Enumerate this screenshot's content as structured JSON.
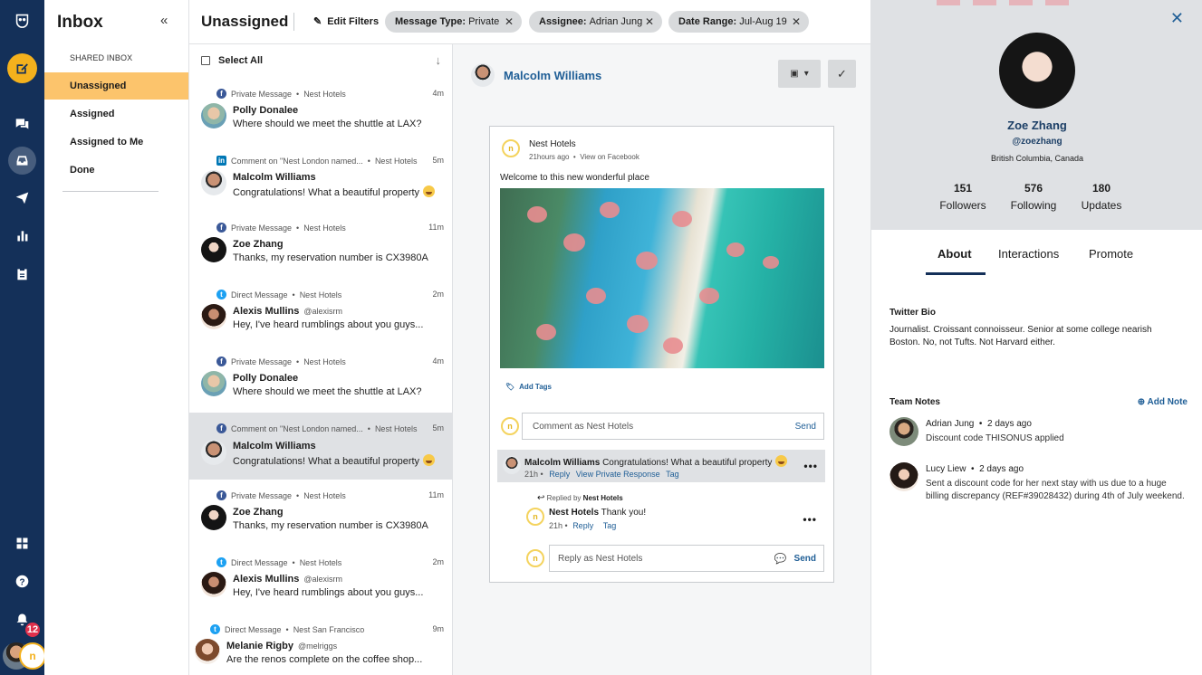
{
  "nav": {
    "title": "Inbox",
    "section_label": "SHARED INBOX",
    "items": [
      {
        "label": "Unassigned"
      },
      {
        "label": "Assigned"
      },
      {
        "label": "Assigned to Me"
      },
      {
        "label": "Done"
      }
    ]
  },
  "rail": {
    "notifications_count": "12"
  },
  "topbar": {
    "title": "Unassigned",
    "edit_filters": "Edit Filters",
    "filters": [
      {
        "key": "Message Type:",
        "value": "Private"
      },
      {
        "key": "Assignee:",
        "value": "Adrian Jung"
      },
      {
        "key": "Date Range:",
        "value": "Jul-Aug 19"
      }
    ]
  },
  "list": {
    "select_all": "Select All",
    "messages": [
      {
        "network": "facebook",
        "type": "Private Message",
        "account": "Nest Hotels",
        "time": "4m",
        "name": "Polly Donalee",
        "handle": "",
        "text": "Where should we meet the shuttle at LAX?"
      },
      {
        "network": "linkedin",
        "type": "Comment on \"Nest London named...",
        "account": "Nest Hotels",
        "time": "5m",
        "name": "Malcolm Williams",
        "handle": "",
        "text": "Congratulations! What a beautiful property"
      },
      {
        "network": "facebook",
        "type": "Private Message",
        "account": "Nest Hotels",
        "time": "11m",
        "name": "Zoe Zhang",
        "handle": "",
        "text": "Thanks, my reservation number is CX3980A"
      },
      {
        "network": "twitter",
        "type": "Direct Message",
        "account": "Nest Hotels",
        "time": "2m",
        "name": "Alexis Mullins",
        "handle": "@alexisrm",
        "text": "Hey, I've heard rumblings about you guys..."
      },
      {
        "network": "facebook",
        "type": "Private Message",
        "account": "Nest Hotels",
        "time": "4m",
        "name": "Polly Donalee",
        "handle": "",
        "text": "Where should we meet the shuttle at LAX?"
      },
      {
        "network": "facebook",
        "type": "Comment on \"Nest London named...",
        "account": "Nest Hotels",
        "time": "5m",
        "name": "Malcolm Williams",
        "handle": "",
        "text": "Congratulations! What a beautiful property"
      },
      {
        "network": "facebook",
        "type": "Private Message",
        "account": "Nest Hotels",
        "time": "11m",
        "name": "Zoe Zhang",
        "handle": "",
        "text": "Thanks, my reservation number is CX3980A"
      },
      {
        "network": "twitter",
        "type": "Direct Message",
        "account": "Nest Hotels",
        "time": "2m",
        "name": "Alexis Mullins",
        "handle": "@alexisrm",
        "text": "Hey, I've heard rumblings about you guys..."
      },
      {
        "network": "twitter",
        "type": "Direct Message",
        "account": "Nest San Francisco",
        "time": "9m",
        "name": "Melanie Rigby",
        "handle": "@melriggs",
        "text": "Are the renos complete on the coffee shop..."
      }
    ]
  },
  "convo": {
    "name": "Malcolm Williams",
    "post": {
      "author": "Nest Hotels",
      "time": "21hours ago",
      "view_link": "View on Facebook",
      "caption": "Welcome to this new wonderful place",
      "add_tags": "Add Tags",
      "comment_placeholder": "Comment as Nest Hotels",
      "send": "Send"
    },
    "comment": {
      "author": "Malcolm Williams",
      "text": "Congratulations! What a beautiful property",
      "time": "21h",
      "reply": "Reply",
      "private": "View Private Response",
      "tag": "Tag"
    },
    "reply": {
      "replied_by_label": "Replied by",
      "replied_by": "Nest Hotels",
      "author": "Nest Hotels",
      "text": "Thank you!",
      "time": "21h",
      "reply": "Reply",
      "tag": "Tag",
      "placeholder": "Reply as Nest Hotels",
      "send": "Send"
    }
  },
  "profile": {
    "name": "Zoe Zhang",
    "handle": "@zoezhang",
    "location": "British Columbia, Canada",
    "stats": [
      {
        "value": "151",
        "label": "Followers"
      },
      {
        "value": "576",
        "label": "Following"
      },
      {
        "value": "180",
        "label": "Updates"
      }
    ],
    "tabs": [
      "About",
      "Interactions",
      "Promote"
    ],
    "bio_title": "Twitter Bio",
    "bio": "Journalist. Croissant connoisseur. Senior at some college nearish Boston. No, not Tufts. Not Harvard either.",
    "notes_title": "Team Notes",
    "add_note": "Add Note",
    "notes": [
      {
        "author": "Adrian Jung",
        "when": "2 days ago",
        "text": "Discount code THISONUS applied"
      },
      {
        "author": "Lucy Liew",
        "when": "2 days ago",
        "text": "Sent a discount code for her next stay with us due to a huge billing discrepancy (REF#39028432) during 4th of July weekend."
      }
    ]
  }
}
